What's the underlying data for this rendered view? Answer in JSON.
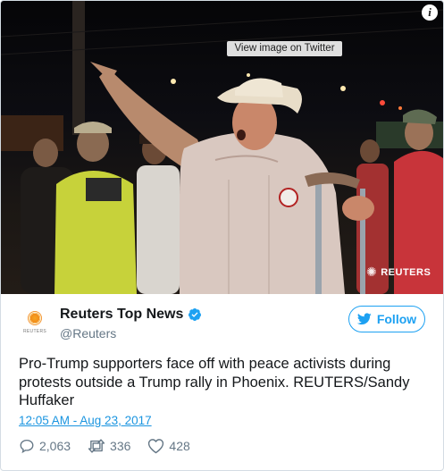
{
  "photo": {
    "view_label": "View image on Twitter",
    "watermark": "REUTERS",
    "info_icon": "i"
  },
  "account": {
    "name": "Reuters Top News",
    "handle": "@Reuters",
    "avatar_text": "REUTERS",
    "verified": true
  },
  "follow_label": "Follow",
  "tweet": {
    "text": "Pro-Trump supporters face off with peace activists during protests outside a Trump rally in Phoenix. REUTERS/Sandy Huffaker",
    "timestamp": "12:05 AM - Aug 23, 2017"
  },
  "actions": {
    "replies": "2,063",
    "retweets": "336",
    "likes": "428"
  },
  "colors": {
    "link": "#1b95e0",
    "follow": "#1da1f2",
    "muted": "#657786"
  },
  "icons": [
    "info-icon",
    "verified-badge-icon",
    "twitter-bird-icon",
    "reply-icon",
    "retweet-icon",
    "like-heart-icon"
  ]
}
